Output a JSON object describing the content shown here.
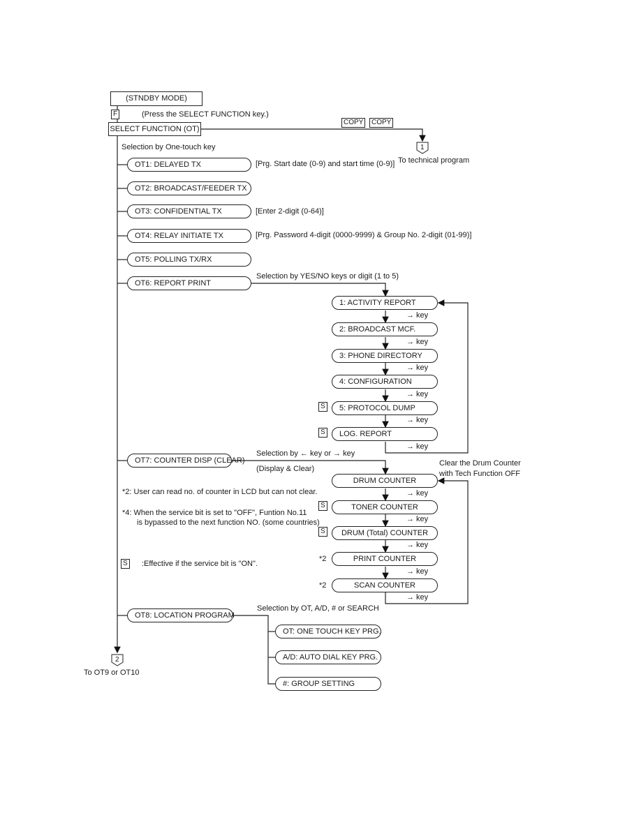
{
  "diagram": {
    "start": "(STNDBY MODE)",
    "f_key": "F",
    "f_key_note": "(Press the SELECT FUNCTION key.)",
    "select_function": "SELECT FUNCTION (OT)",
    "copy_keys": [
      "COPY",
      "COPY"
    ],
    "connector_1": {
      "label": "1",
      "caption": "To technical program"
    },
    "one_touch_caption": "Selection by One-touch key",
    "ot_items": [
      {
        "label": "OT1: DELAYED TX",
        "note": "[Prg. Start date (0-9) and start time (0-9)]"
      },
      {
        "label": "OT2: BROADCAST/FEEDER TX",
        "note": ""
      },
      {
        "label": "OT3: CONFIDENTIAL TX",
        "note": "[Enter 2-digit (0-64)]"
      },
      {
        "label": "OT4: RELAY INITIATE TX",
        "note": "[Prg. Password 4-digit (0000-9999) & Group No. 2-digit (01-99)]"
      },
      {
        "label": "OT5: POLLING TX/RX",
        "note": ""
      },
      {
        "label": "OT6: REPORT PRINT",
        "note": ""
      },
      {
        "label": "OT7: COUNTER DISP (CLEAR)",
        "note": ""
      },
      {
        "label": "OT8: LOCATION PROGRAM",
        "note": ""
      }
    ],
    "ot6_caption": "Selection by YES/NO keys or digit (1 to 5)",
    "reports": [
      {
        "label": "1: ACTIVITY REPORT",
        "marker": ""
      },
      {
        "label": "2: BROADCAST MCF.",
        "marker": ""
      },
      {
        "label": "3: PHONE DIRECTORY",
        "marker": ""
      },
      {
        "label": "4: CONFIGURATION",
        "marker": ""
      },
      {
        "label": "5: PROTOCOL DUMP",
        "marker": "S"
      },
      {
        "label": "LOG. REPORT",
        "marker": "S"
      }
    ],
    "arrow_key": "→ key",
    "ot7_caption": "Selection by ← key or → key",
    "ot7_subcaption": "(Display & Clear)",
    "drum_clear_note_1": "Clear the Drum Counter",
    "drum_clear_note_2": "with Tech Function OFF",
    "counters": [
      {
        "label": "DRUM COUNTER",
        "marker": ""
      },
      {
        "label": "TONER COUNTER",
        "marker": "S"
      },
      {
        "label": "DRUM (Total) COUNTER",
        "marker": "S"
      },
      {
        "label": "PRINT COUNTER",
        "marker": "*2"
      },
      {
        "label": "SCAN COUNTER",
        "marker": "*2"
      }
    ],
    "notes": {
      "note2": "*2:  User can read no. of counter in LCD but can not clear.",
      "note4_line1": "*4:  When the service bit is set to \"OFF\", Funtion No.11",
      "note4_line2": "is bypassed to the next function NO. (some countries)",
      "s_key": "S",
      "s_note": ":Effective if the service bit is \"ON\"."
    },
    "ot8_caption": "Selection by OT, A/D, # or SEARCH",
    "location_items": [
      "OT: ONE TOUCH KEY PRG.",
      "A/D: AUTO DIAL KEY PRG.",
      "#: GROUP SETTING"
    ],
    "connector_2": {
      "label": "2",
      "caption": "To OT9 or OT10"
    }
  }
}
